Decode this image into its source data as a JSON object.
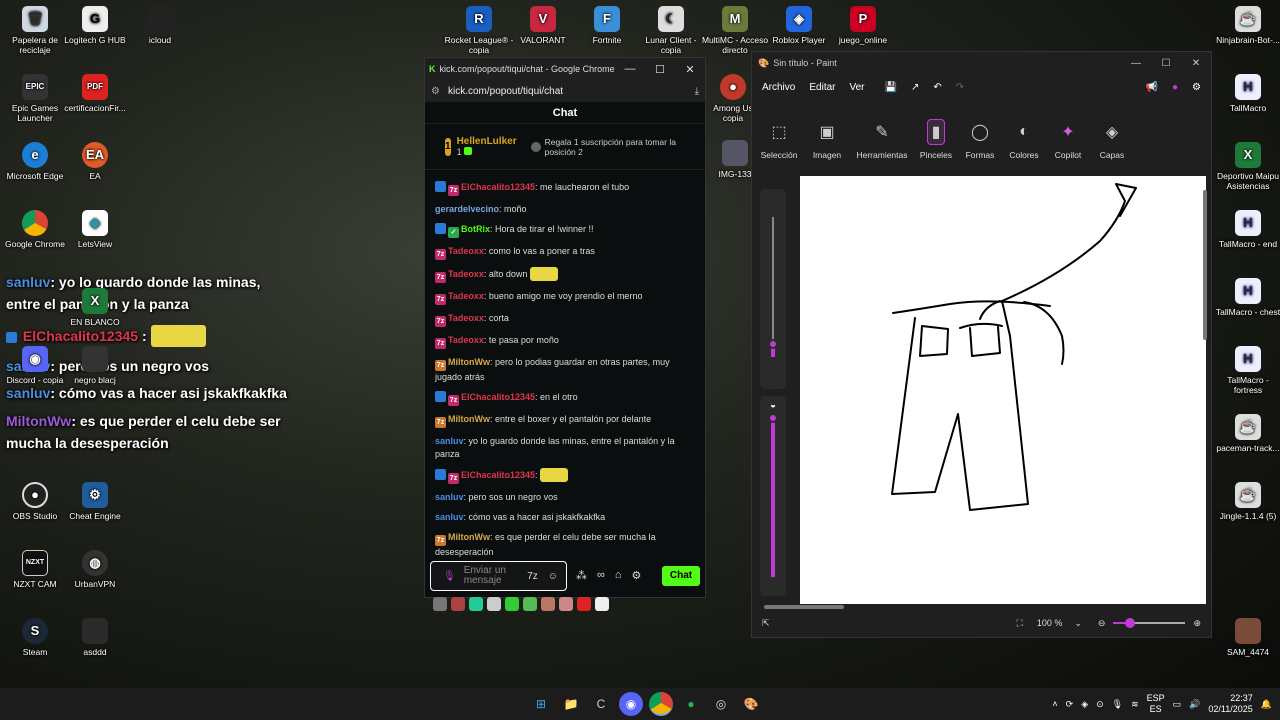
{
  "desktop": {
    "icons_left": [
      {
        "label": "Papelera de reciclaje",
        "x": 0,
        "y": 0
      },
      {
        "label": "Logitech G HUB"
      },
      {
        "label": "icloud"
      },
      {
        "label": "Epic Games Launcher"
      },
      {
        "label": "certificacionFir..."
      },
      {
        "label": "Microsoft Edge"
      },
      {
        "label": "EA"
      },
      {
        "label": "Google Chrome"
      },
      {
        "label": "LetsView"
      },
      {
        "label": "EN BLANCO"
      },
      {
        "label": "Discord - copia"
      },
      {
        "label": "negro blacj"
      },
      {
        "label": "OBS Studio"
      },
      {
        "label": "Cheat Engine"
      },
      {
        "label": "NZXT CAM"
      },
      {
        "label": "UrbanVPN"
      },
      {
        "label": "Steam"
      },
      {
        "label": "asddd"
      }
    ],
    "icons_top": [
      {
        "label": "Rocket League® - copia"
      },
      {
        "label": "VALORANT"
      },
      {
        "label": "Fortnite"
      },
      {
        "label": "Lunar Client - copia"
      },
      {
        "label": "MultiMC - Acceso directo"
      },
      {
        "label": "Roblox Player"
      },
      {
        "label": "juego_online"
      },
      {
        "label": "Among Us copia"
      },
      {
        "label": "IMG-133"
      }
    ],
    "icons_right": [
      {
        "label": "Ninjabrain-Bot-..."
      },
      {
        "label": "TallMacro"
      },
      {
        "label": "Deportivo Maipu Asistencias"
      },
      {
        "label": "TallMacro - end"
      },
      {
        "label": "TallMacro - chest"
      },
      {
        "label": "TallMacro - fortress"
      },
      {
        "label": "paceman-track..."
      },
      {
        "label": "Jingle-1.1.4 (5)"
      },
      {
        "label": "SAM_4474"
      }
    ],
    "overlay": {
      "l1_user": "sanluv",
      "l1_text": ": yo lo guardo donde las minas,",
      "l2_text": "entre el pantalón y la panza",
      "l3_user": "ElChacalito12345",
      "l3_text": ":",
      "l4_user": "sanluv",
      "l4_text": ": pero sos un negro vos",
      "l5_user": "sanluv",
      "l5_text": ": cómo vas a hacer asi jskakfkakfka",
      "l6_user": "MiltonWw",
      "l6_text": ": es que perder el celu debe ser",
      "l7_text": "mucha la desesperación"
    }
  },
  "kick": {
    "window_title": "kick.com/popout/tiqui/chat - Google Chrome",
    "url": "kick.com/popout/tiqui/chat",
    "chat_title": "Chat",
    "pinned_user": "HellenLulker",
    "pinned_count": "1",
    "pinned_cta": "Regala 1 suscripción para tomar la posición 2",
    "messages": [
      {
        "user": "ElChacalito12345",
        "text": ": me lauchearon el tubo",
        "color": "#e0354a"
      },
      {
        "user": "gerardelvecino",
        "text": ": moño",
        "color": "#7aa6e0"
      },
      {
        "user": "BotRix",
        "text": ": Hora de tirar el !winner !!",
        "color": "#53fc18"
      },
      {
        "user": "Tadeoxx",
        "text": ": como lo vas a poner a tras",
        "color": "#e0354a"
      },
      {
        "user": "Tadeoxx",
        "text": ": alto down",
        "color": "#e0354a"
      },
      {
        "user": "Tadeoxx",
        "text": ": bueno amigo me voy prendio el merno",
        "color": "#e0354a"
      },
      {
        "user": "Tadeoxx",
        "text": ": corta",
        "color": "#e0354a"
      },
      {
        "user": "Tadeoxx",
        "text": ": te pasa por moño",
        "color": "#e0354a"
      },
      {
        "user": "MiltonWw",
        "text": ": pero lo podias guardar en otras partes, muy jugado atrás",
        "color": "#d4a84b"
      },
      {
        "user": "ElChacalito12345",
        "text": ": en el otro",
        "color": "#e0354a"
      },
      {
        "user": "MiltonWw",
        "text": ": entre el boxer y el pantalón por delante",
        "color": "#d4a84b"
      },
      {
        "user": "sanluv",
        "text": ": yo lo guardo donde las minas, entre el pantalón y la panza",
        "color": "#4b8fe0"
      },
      {
        "user": "ElChacalito12345",
        "text": ":",
        "color": "#e0354a"
      },
      {
        "user": "sanluv",
        "text": ": pero sos un negro vos",
        "color": "#4b8fe0"
      },
      {
        "user": "sanluv",
        "text": ": cómo vas a hacer asi jskakfkakfka",
        "color": "#4b8fe0"
      },
      {
        "user": "MiltonWw",
        "text": ": es que perder el celu debe ser mucha la desesperación",
        "color": "#d4a84b"
      }
    ],
    "input_placeholder": "Enviar un mensaje",
    "send_label": "Chat"
  },
  "paint": {
    "window_title": "Sin título - Paint",
    "menu": [
      "Archivo",
      "Editar",
      "Ver"
    ],
    "tools": [
      "Selección",
      "Imagen",
      "Herramientas",
      "Pinceles",
      "Formas",
      "Colores",
      "Copilot",
      "Capas"
    ],
    "zoom": "100 %"
  },
  "taskbar": {
    "lang_top": "ESP",
    "lang_bottom": "ES",
    "time": "22:37",
    "date": "02/11/2025"
  }
}
